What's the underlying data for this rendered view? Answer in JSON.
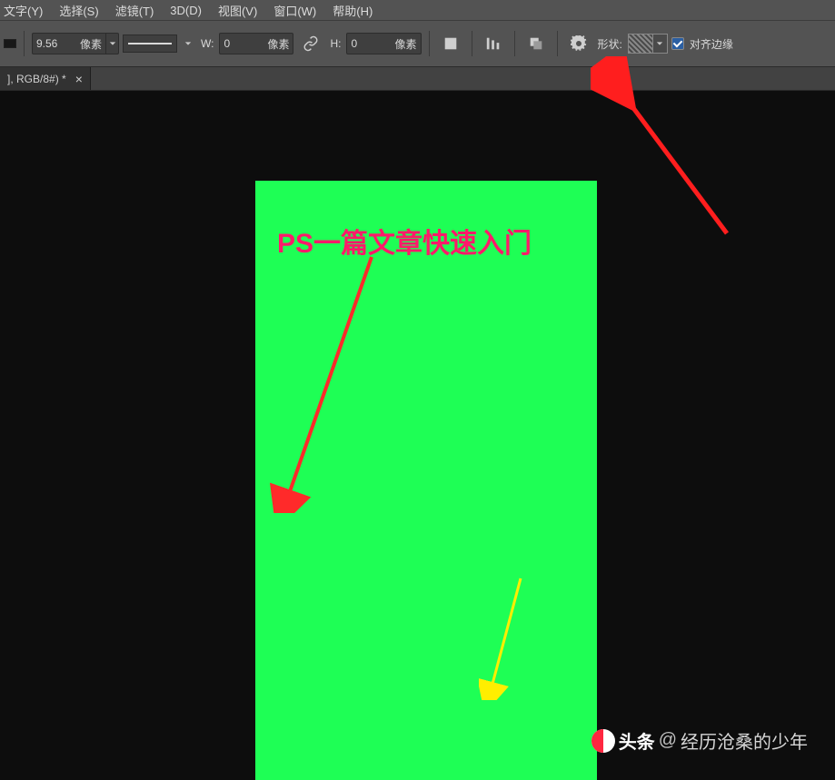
{
  "menu": {
    "items": [
      {
        "label": "文字(Y)"
      },
      {
        "label": "选择(S)"
      },
      {
        "label": "滤镜(T)"
      },
      {
        "label": "3D(D)"
      },
      {
        "label": "视图(V)"
      },
      {
        "label": "窗口(W)"
      },
      {
        "label": "帮助(H)"
      }
    ]
  },
  "options": {
    "stroke_value": "9.56",
    "stroke_unit": "像素",
    "W_label": "W:",
    "W_value": "0",
    "W_unit": "像素",
    "H_label": "H:",
    "H_value": "0",
    "H_unit": "像素",
    "shape_label": "形状:",
    "align_edges_label": "对齐边缘"
  },
  "tab": {
    "title": "], RGB/8#) *",
    "close": "×"
  },
  "canvas": {
    "headline": "PS一篇文章快速入门"
  },
  "watermark": {
    "brand": "头条",
    "at": "@",
    "name": "经历沧桑的少年"
  }
}
